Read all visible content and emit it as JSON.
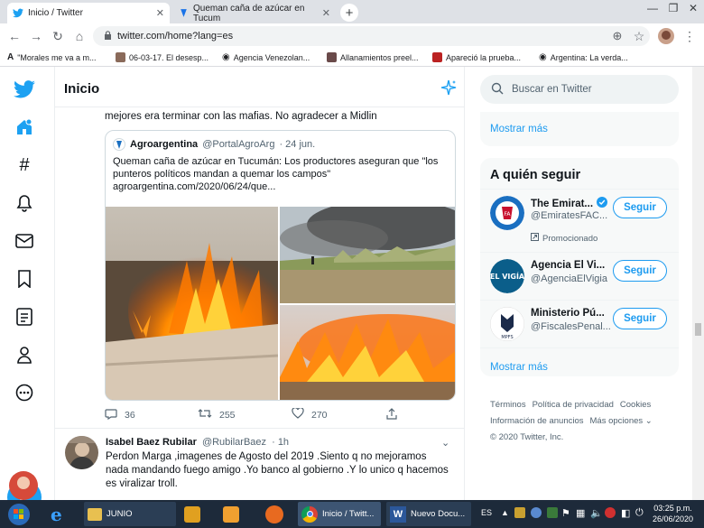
{
  "browser": {
    "tabs": [
      {
        "title": "Inicio / Twitter",
        "active": true
      },
      {
        "title": "Queman caña de azúcar en Tucum",
        "active": false
      }
    ],
    "url": "twitter.com/home?lang=es",
    "bookmarks": [
      "\"Morales me va a m...",
      "06-03-17. El desesp...",
      "Agencia Venezolan...",
      "Allanamientos preel...",
      "Apareció la prueba...",
      "Argentina: La verda..."
    ]
  },
  "feed": {
    "title": "Inicio",
    "tweet1": {
      "text": "mejores era terminar con las mafias. No agradecer a Midlin",
      "quote": {
        "author": "Agroargentina",
        "handle": "@PortalAgroArg",
        "time": "· 24 jun.",
        "text": "Queman caña de azúcar en Tucumán: Los productores aseguran que \"los punteros políticos mandan a quemar los campos\" agroargentina.com/2020/06/24/que..."
      },
      "replies": "36",
      "retweets": "255",
      "likes": "270"
    },
    "tweet2": {
      "author": "Isabel Baez Rubilar",
      "handle": "@RubilarBaez",
      "time": "· 1h",
      "text": "Perdon Marga ,imagenes de Agosto del 2019 .Siento q no mejoramos nada mandando fuego amigo .Yo banco al gobierno .Y lo unico q hacemos es viralizar troll."
    }
  },
  "sidebar": {
    "search_placeholder": "Buscar en Twitter",
    "show_more_top": "Mostrar más",
    "who_to_follow": {
      "title": "A quién seguir",
      "accounts": [
        {
          "name": "The Emirat...",
          "handle": "@EmiratesFAC...",
          "button": "Seguir",
          "promoted": "Promocionado"
        },
        {
          "name": "Agencia El Vi...",
          "handle": "@AgenciaElVigia",
          "button": "Seguir"
        },
        {
          "name": "Ministerio Pú...",
          "handle": "@FiscalesPenal...",
          "button": "Seguir"
        }
      ],
      "show_more": "Mostrar más"
    },
    "footer": {
      "terms": "Términos",
      "privacy": "Política de privacidad",
      "cookies": "Cookies",
      "ads": "Información de anuncios",
      "more": "Más opciones ⌄",
      "copyright": "© 2020 Twitter, Inc."
    }
  },
  "taskbar": {
    "items": [
      "JUNIO",
      "Inicio / Twitt...",
      "Nuevo Docu..."
    ],
    "lang": "ES",
    "time": "03:25 p.m.",
    "date": "26/06/2020"
  },
  "colors": {
    "accent": "#1d9bf0",
    "brand": "#1da1f2"
  }
}
